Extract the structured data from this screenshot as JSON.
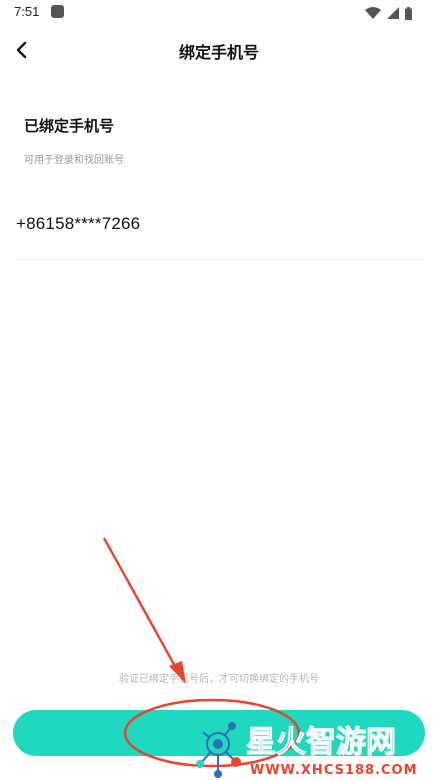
{
  "status_bar": {
    "time": "7:51",
    "icons": [
      "app-notification-icon",
      "wifi-icon",
      "signal-icon",
      "battery-icon"
    ]
  },
  "header": {
    "back_icon": "chevron-left-icon",
    "title": "绑定手机号"
  },
  "bound_section": {
    "title": "已绑定手机号",
    "subtitle": "可用于登录和找回账号",
    "phone": "+86158****7266"
  },
  "footer": {
    "hint": "验证已绑定手机号后，才可切换绑定的手机号",
    "button_label": ""
  },
  "annotation": {
    "color": "#e8442e",
    "shapes": [
      "arrow",
      "ellipse"
    ]
  },
  "watermark": {
    "brand": "星火智游网",
    "url": "www.xhcs188.com",
    "brand_color": "#1a4fa3",
    "url_color": "#e8442e"
  },
  "colors": {
    "accent": "#1ed8bf",
    "text_primary": "#111111",
    "text_secondary": "#9a9a9a"
  }
}
